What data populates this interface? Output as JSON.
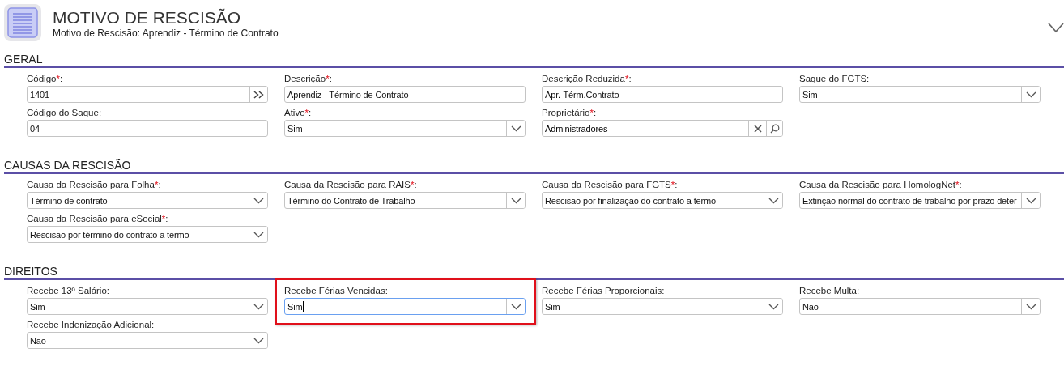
{
  "header": {
    "title": "MOTIVO DE RESCISÃO",
    "subtitle": "Motivo de Rescisão: Aprendiz - Término de Contrato"
  },
  "sections": [
    {
      "title": "GERAL",
      "fields": [
        {
          "kind": "lookup",
          "label": "Código",
          "mark": "*",
          "tail": ":",
          "value": "1401"
        },
        {
          "kind": "text",
          "label": "Descrição",
          "mark": "*",
          "tail": ":",
          "value": "Aprendiz - Término de Contrato"
        },
        {
          "kind": "text",
          "label": "Descrição Reduzida",
          "mark": "*",
          "tail": ":",
          "value": "Apr.-Térm.Contrato"
        },
        {
          "kind": "select",
          "label": "Saque do FGTS:",
          "value": "Sim"
        },
        {
          "kind": "text",
          "label": "Código do Saque:",
          "value": "04"
        },
        {
          "kind": "select",
          "label": "Ativo",
          "mark": "*",
          "tail": ":",
          "value": "Sim"
        },
        {
          "kind": "owner",
          "label": "Proprietário",
          "mark": "*",
          "tail": ":",
          "value": "Administradores"
        }
      ]
    },
    {
      "title": "CAUSAS DA RESCISÃO",
      "fields": [
        {
          "kind": "select",
          "label": "Causa da Rescisão para Folha",
          "mark": "*",
          "tail": ":",
          "value": "Término de contrato"
        },
        {
          "kind": "select",
          "label": "Causa da Rescisão para RAIS",
          "mark": "*",
          "tail": ":",
          "value": "Término do Contrato de Trabalho"
        },
        {
          "kind": "select",
          "label": "Causa da Rescisão para FGTS",
          "mark": "*",
          "tail": ":",
          "value": "Rescisão por finalização do contrato a termo"
        },
        {
          "kind": "select",
          "label": "Causa da Rescisão para HomologNet",
          "mark": "*",
          "tail": ":",
          "value": "Extinção normal do contrato de trabalho por prazo deter"
        },
        {
          "kind": "select",
          "label": "Causa da Rescisão para eSocial",
          "mark": "*",
          "tail": ":",
          "value": "Rescisão por término do contrato a termo"
        }
      ]
    },
    {
      "title": "DIREITOS",
      "fields": [
        {
          "kind": "select",
          "label": "Recebe 13º Salário:",
          "value": "Sim"
        },
        {
          "kind": "select",
          "label": "Recebe Férias Vencidas:",
          "value": "Sim",
          "focused": true,
          "highlighted": true
        },
        {
          "kind": "select",
          "label": "Recebe Férias Proporcionais:",
          "value": "Sim"
        },
        {
          "kind": "select",
          "label": "Recebe Multa:",
          "value": "Não"
        },
        {
          "kind": "select",
          "label": "Recebe Indenização Adicional:",
          "value": "Não"
        }
      ]
    }
  ]
}
